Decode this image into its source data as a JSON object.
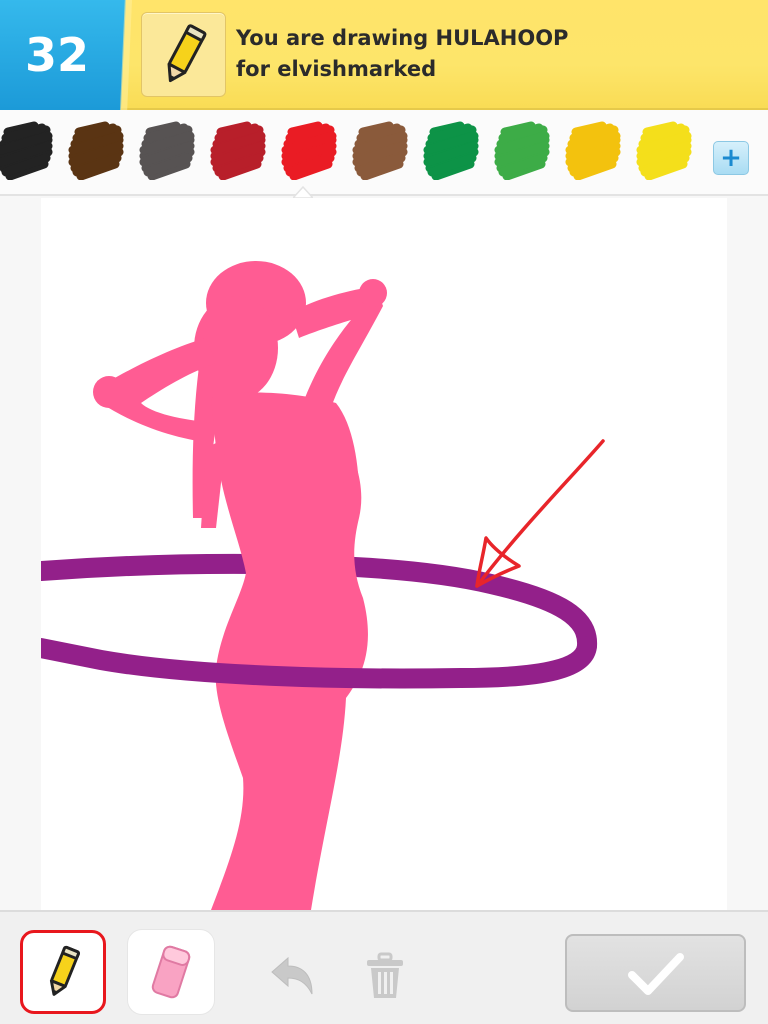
{
  "header": {
    "score": "32",
    "line1": "You are drawing HULAHOOP",
    "line2": "for elvishmarked",
    "icon": "pencil-icon"
  },
  "palette": {
    "colors": [
      "#232323",
      "#5a3413",
      "#575353",
      "#b81f2a",
      "#ea1c24",
      "#8a5a3b",
      "#0d9347",
      "#3dac47",
      "#f3c20e",
      "#f4df1b"
    ],
    "selected_index": 4,
    "add_icon": "plus-icon",
    "add_label": "+"
  },
  "canvas": {
    "figure_color": "#ff5c93",
    "hoop_color": "#93208a",
    "arrow_color": "#e8252a"
  },
  "toolbar": {
    "tools": [
      {
        "name": "pencil",
        "icon": "pencil-icon",
        "selected": true
      },
      {
        "name": "eraser",
        "icon": "eraser-icon",
        "selected": false
      }
    ],
    "undo_icon": "undo-icon",
    "trash_icon": "trash-icon",
    "done_icon": "checkmark-icon",
    "selected_outline_color": "#e8171d"
  }
}
